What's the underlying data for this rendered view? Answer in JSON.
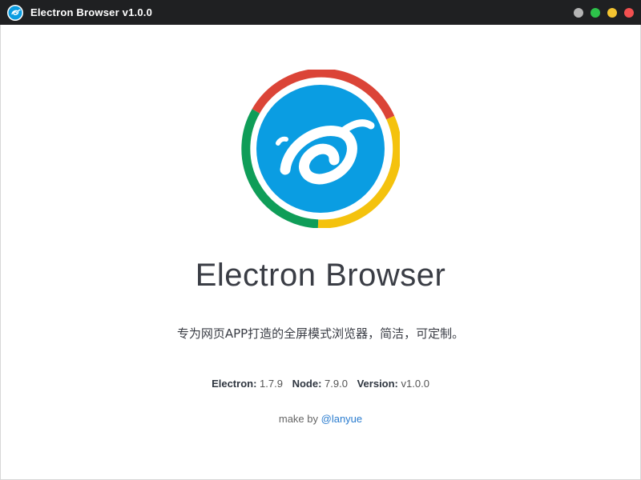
{
  "window": {
    "title": "Electron Browser v1.0.0",
    "icon": "e-swirl-icon",
    "controls": [
      {
        "name": "minimize-button",
        "color": "#b4b4b4"
      },
      {
        "name": "maximize-button",
        "color": "#2dc24a"
      },
      {
        "name": "fullscreen-button",
        "color": "#f4c430"
      },
      {
        "name": "close-button",
        "color": "#f25050"
      }
    ]
  },
  "about": {
    "logo_icon": "electron-browser-logo",
    "ring_colors": [
      "#db4437",
      "#f4c20d",
      "#0f9d58"
    ],
    "logo_fill": "#0a9de2",
    "name": "Electron Browser",
    "description": "专为网页APP打造的全屏模式浏览器，简洁，可定制。",
    "versions": [
      {
        "label": "Electron:",
        "value": "1.7.9"
      },
      {
        "label": "Node:",
        "value": "7.9.0"
      },
      {
        "label": "Version:",
        "value": "v1.0.0"
      }
    ],
    "credit_prefix": "make by",
    "credit_link": "@lanyue"
  }
}
